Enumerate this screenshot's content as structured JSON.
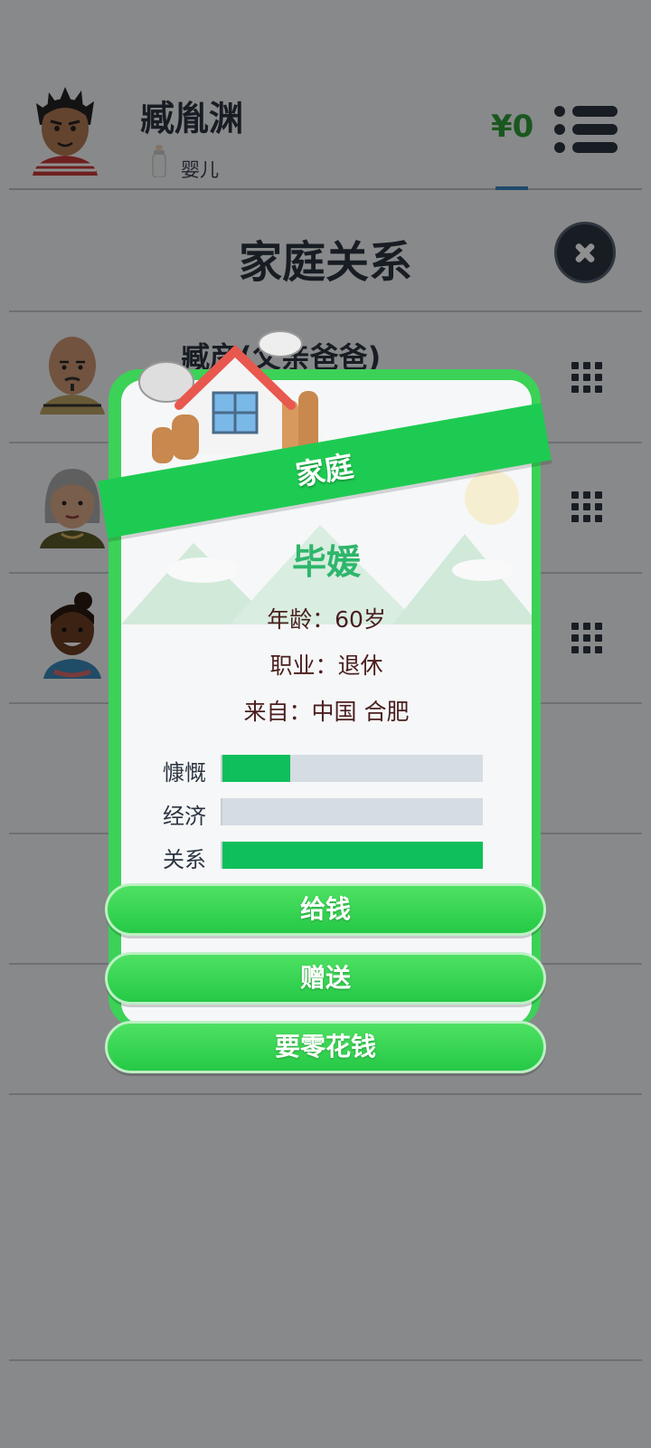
{
  "header": {
    "player_name": "臧胤渊",
    "life_stage": "婴儿",
    "money": "¥0"
  },
  "family_screen": {
    "title": "家庭关系",
    "relatives": [
      {
        "name": "臧彦(父亲爸爸)"
      }
    ]
  },
  "modal": {
    "banner": "家庭",
    "member_name": "毕媛",
    "age_line": "年龄：60岁",
    "occupation_line": "职业：退休",
    "origin_line": "来自：中国 合肥",
    "stats": [
      {
        "label": "慷慨",
        "value": 0.26
      },
      {
        "label": "经济",
        "value": 0.0
      },
      {
        "label": "关系",
        "value": 1.0
      }
    ],
    "buttons": {
      "give_money": "给钱",
      "gift": "赠送",
      "ask_allowance": "要零花钱"
    }
  },
  "colors": {
    "banner_green": "#1ecb52",
    "name_green": "#2eb66c",
    "stat_fill": "#0fbf5c",
    "money_green": "#2f9b3a"
  }
}
